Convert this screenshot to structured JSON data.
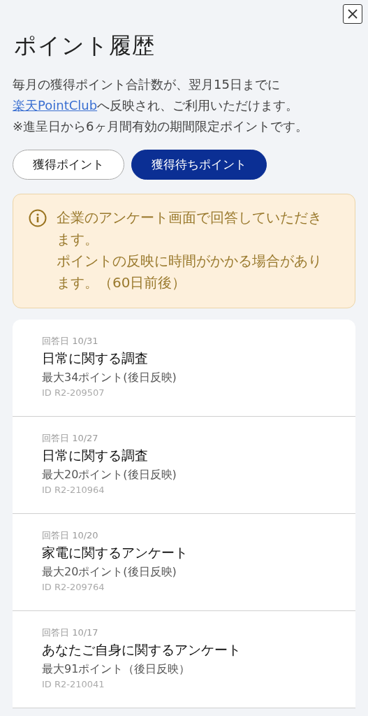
{
  "title": "ポイント履歴",
  "description": {
    "line_1": "毎月の獲得ポイント合計数が、翌月15日までに",
    "link": "楽天PointClub",
    "line_2_rest": "へ反映され、ご利用いただけます。"
  },
  "note": "※進呈日から6ヶ月間有効の期間限定ポイントです。",
  "tabs": [
    {
      "label": "獲得ポイント",
      "selected": false
    },
    {
      "label": "獲得待ちポイント",
      "selected": true
    }
  ],
  "notice": [
    "企業のアンケート画面で回答していただきます。",
    "ポイントの反映に時間がかかる場合があります。（60日前後）"
  ],
  "history": [
    {
      "date": "回答日 10/31",
      "title": "日常に関する調査",
      "points": "最大34ポイント(後日反映)",
      "id": "ID R2-209507"
    },
    {
      "date": "回答日 10/27",
      "title": "日常に関する調査",
      "points": "最大20ポイント(後日反映)",
      "id": "ID R2-210964"
    },
    {
      "date": "回答日 10/20",
      "title": "家電に関するアンケート",
      "points": "最大20ポイント(後日反映)",
      "id": "ID R2-209764"
    },
    {
      "date": "回答日 10/17",
      "title": "あなたご自身に関するアンケート",
      "points": "最大91ポイント（後日反映）",
      "id": "ID R2-210041"
    }
  ]
}
